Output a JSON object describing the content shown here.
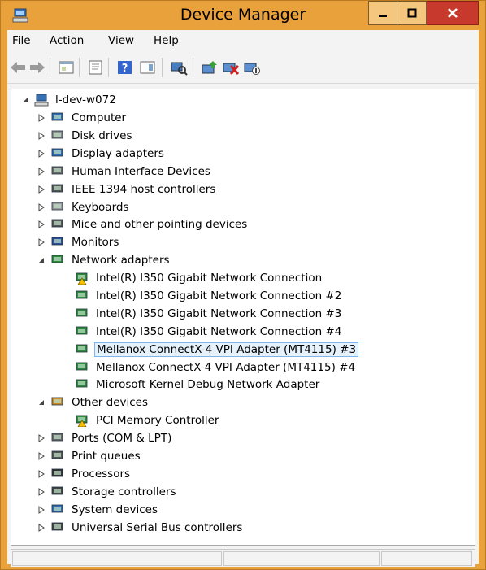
{
  "window": {
    "title": "Device Manager",
    "minimize_glyph": "",
    "colors": {
      "frame": "#e8a13b",
      "close": "#c7392c"
    }
  },
  "menubar": {
    "items": [
      "File",
      "Action",
      "View",
      "Help"
    ]
  },
  "toolbar": {
    "icons": [
      "back-icon",
      "forward-icon",
      "properties-icon",
      "show-hide-console-tree-icon",
      "help-icon",
      "action-pane-icon",
      "scan-hardware-icon",
      "update-driver-icon",
      "uninstall-device-icon",
      "disable-device-icon"
    ]
  },
  "tree": {
    "root": "l-dev-w072",
    "categories": [
      {
        "label": "Computer",
        "icon": "computer-icon"
      },
      {
        "label": "Disk drives",
        "icon": "disk-drive-icon"
      },
      {
        "label": "Display adapters",
        "icon": "display-adapter-icon"
      },
      {
        "label": "Human Interface Devices",
        "icon": "hid-icon"
      },
      {
        "label": "IEEE 1394 host controllers",
        "icon": "ieee1394-icon"
      },
      {
        "label": "Keyboards",
        "icon": "keyboard-icon"
      },
      {
        "label": "Mice and other pointing devices",
        "icon": "mouse-icon"
      },
      {
        "label": "Monitors",
        "icon": "monitor-icon"
      },
      {
        "label": "Network adapters",
        "icon": "network-adapter-icon"
      },
      {
        "label": "Other devices",
        "icon": "other-devices-icon"
      },
      {
        "label": "Ports (COM & LPT)",
        "icon": "port-icon"
      },
      {
        "label": "Print queues",
        "icon": "printer-icon"
      },
      {
        "label": "Processors",
        "icon": "processor-icon"
      },
      {
        "label": "Storage controllers",
        "icon": "storage-controller-icon"
      },
      {
        "label": "System devices",
        "icon": "system-device-icon"
      },
      {
        "label": "Universal Serial Bus controllers",
        "icon": "usb-icon"
      }
    ],
    "network_children": [
      "Intel(R) I350 Gigabit Network Connection",
      "Intel(R) I350 Gigabit Network Connection #2",
      "Intel(R) I350 Gigabit Network Connection #3",
      "Intel(R) I350 Gigabit Network Connection #4",
      "Mellanox ConnectX-4 VPI Adapter (MT4115) #3",
      "Mellanox ConnectX-4 VPI Adapter (MT4115) #4",
      "Microsoft Kernel Debug Network Adapter"
    ],
    "other_children": [
      "PCI Memory Controller"
    ],
    "selected": "Mellanox ConnectX-4 VPI Adapter (MT4115) #3"
  }
}
